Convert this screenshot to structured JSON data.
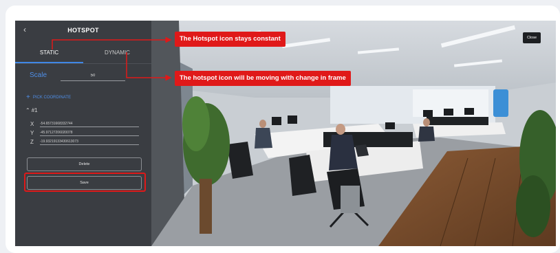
{
  "panel": {
    "back_icon": "chevron-left-icon",
    "title": "HOTSPOT",
    "tabs": [
      "STATIC",
      "DYNAMIC"
    ],
    "active_tab": "STATIC",
    "scale_label": "Scale",
    "scale_value": "50",
    "pick_coordinate_label": "PICK  COORDINATE",
    "point_label": "#1",
    "coords": [
      {
        "axis": "X",
        "value": "-54.65731668332744"
      },
      {
        "axis": "Y",
        "value": "-45.97127206020078"
      },
      {
        "axis": "Z",
        "value": "-19.93219133430613073"
      }
    ],
    "delete_label": "Delete",
    "save_label": "Save"
  },
  "scene": {
    "close_label": "Close"
  },
  "annotations": {
    "static_note": "The Hotspot icon stays constant",
    "dynamic_note": "The hotspot icon will be moving with change in frame"
  },
  "colors": {
    "accent_blue": "#3f87e6",
    "annotation_red": "#e01919",
    "panel_bg": "#3a3d42"
  }
}
